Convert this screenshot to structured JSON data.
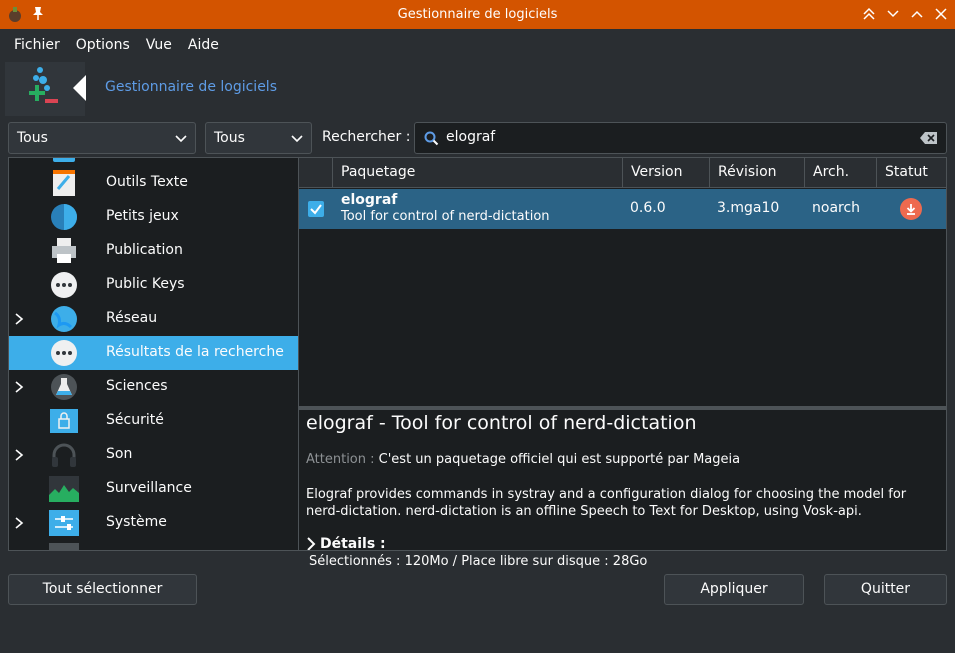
{
  "window": {
    "title": "Gestionnaire de logiciels"
  },
  "menu": [
    "Fichier",
    "Options",
    "Vue",
    "Aide"
  ],
  "banner": {
    "title": "Gestionnaire de logiciels"
  },
  "filters": {
    "filter1": "Tous",
    "filter2": "Tous"
  },
  "search": {
    "label": "Rechercher :",
    "value": "elograf"
  },
  "categories": [
    {
      "label": "Outils Texte",
      "icon": "text-tools-icon",
      "expandable": false
    },
    {
      "label": "Petits jeux",
      "icon": "small-games-icon",
      "expandable": false
    },
    {
      "label": "Publication",
      "icon": "printer-icon",
      "expandable": false
    },
    {
      "label": "Public Keys",
      "icon": "more-icon",
      "expandable": false
    },
    {
      "label": "Réseau",
      "icon": "globe-icon",
      "expandable": true
    },
    {
      "label": "Résultats de la recherche",
      "icon": "more-icon",
      "expandable": false,
      "selected": true
    },
    {
      "label": "Sciences",
      "icon": "flask-icon",
      "expandable": true
    },
    {
      "label": "Sécurité",
      "icon": "lock-icon",
      "expandable": false
    },
    {
      "label": "Son",
      "icon": "headphones-icon",
      "expandable": true
    },
    {
      "label": "Surveillance",
      "icon": "monitor-chart-icon",
      "expandable": false
    },
    {
      "label": "Système",
      "icon": "settings-panel-icon",
      "expandable": true
    }
  ],
  "table": {
    "headers": [
      "Paquetage",
      "Version",
      "Révision",
      "Arch.",
      "Statut"
    ],
    "rows": [
      {
        "name": "elograf",
        "summary": "Tool for control of nerd-dictation",
        "version": "0.6.0",
        "revision": "3.mga10",
        "arch": "noarch",
        "status": "install-icon",
        "checked": true
      }
    ]
  },
  "details": {
    "title": "elograf - Tool for control of nerd-dictation",
    "attention_label": "Attention :",
    "attention_text": "C'est un paquetage officiel qui est supporté par Mageia",
    "description": "Elograf provides commands in systray and a configuration dialog for choosing the model for nerd-dictation. nerd-dictation is an offline Speech to Text for Desktop, using Vosk-api.",
    "more_label": "Détails :"
  },
  "status_text": "Sélectionnés : 120Mo / Place libre sur disque : 28Go",
  "buttons": {
    "select_all": "Tout sélectionner",
    "apply": "Appliquer",
    "quit": "Quitter"
  },
  "colors": {
    "titlebar": "#d35400",
    "selection": "#3daee9",
    "row_selection": "#2b6386",
    "link": "#5e9ce6"
  }
}
